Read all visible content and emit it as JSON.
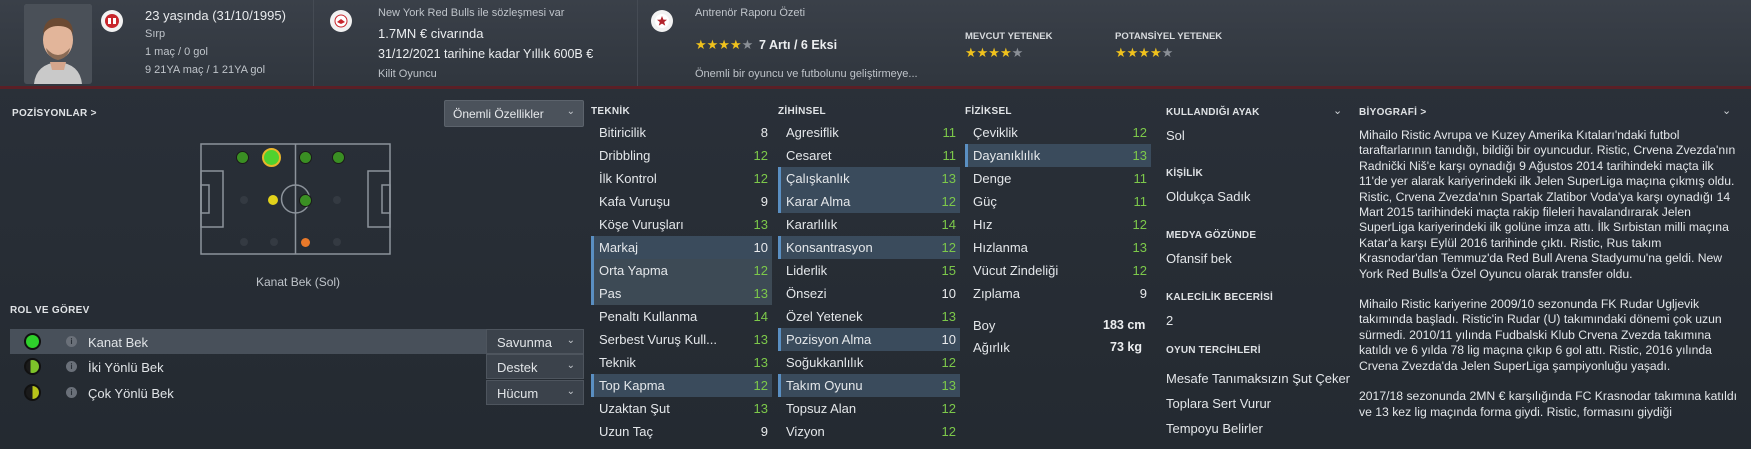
{
  "header": {
    "age_line": "23 yaşında (31/10/1995)",
    "nationality": "Sırp",
    "caps": "1 maç / 0 gol",
    "u21_caps": "9 21YA maç / 1 21YA gol",
    "contract_with": "New York Red Bulls ile sözleşmesi var",
    "value": "1.7MN € civarında",
    "contract_until": "31/12/2021 tarihine kadar Yıllık 600B €",
    "squad_status": "Kilit Oyuncu",
    "report_title": "Antrenör Raporu Özeti",
    "report_stars": 4,
    "report_summary": "7 Artı / 6 Eksi",
    "report_desc": "Önemli bir oyuncu ve futbolunu geliştirmeye...",
    "current_ability_label": "MEVCUT YETENEK",
    "current_ability_stars": 4,
    "potential_ability_label": "POTANSİYEL YETENEK",
    "potential_ability_stars": 4
  },
  "positions": {
    "title": "POZİSYONLAR",
    "chevron": ">",
    "dropdown_label": "Önemli Özellikler",
    "position_name": "Kanat Bek (Sol)"
  },
  "roles": {
    "title": "ROL VE GÖREV",
    "items": [
      {
        "name": "Kanat Bek",
        "duty": "Savunma",
        "dot_color": "#2ed02b"
      },
      {
        "name": "İki Yönlü Bek",
        "duty": "Destek",
        "dot_color": "#7ec42a"
      },
      {
        "name": "Çok Yönlü Bek",
        "duty": "Hücum",
        "dot_color": "#b8c41a"
      }
    ]
  },
  "technical": {
    "title": "TEKNİK",
    "rows": [
      {
        "label": "Bitiricilik",
        "value": "8"
      },
      {
        "label": "Dribbling",
        "value": "12"
      },
      {
        "label": "İlk Kontrol",
        "value": "12"
      },
      {
        "label": "Kafa Vuruşu",
        "value": "9"
      },
      {
        "label": "Köşe Vuruşları",
        "value": "13"
      },
      {
        "label": "Markaj",
        "value": "10"
      },
      {
        "label": "Orta Yapma",
        "value": "12"
      },
      {
        "label": "Pas",
        "value": "13"
      },
      {
        "label": "Penaltı Kullanma",
        "value": "14"
      },
      {
        "label": "Serbest Vuruş Kull...",
        "value": "13"
      },
      {
        "label": "Teknik",
        "value": "13"
      },
      {
        "label": "Top Kapma",
        "value": "12"
      },
      {
        "label": "Uzaktan Şut",
        "value": "13"
      },
      {
        "label": "Uzun Taç",
        "value": "9"
      }
    ]
  },
  "mental": {
    "title": "ZİHİNSEL",
    "rows": [
      {
        "label": "Agresiflik",
        "value": "11"
      },
      {
        "label": "Cesaret",
        "value": "11"
      },
      {
        "label": "Çalışkanlık",
        "value": "13"
      },
      {
        "label": "Karar Alma",
        "value": "12"
      },
      {
        "label": "Kararlılık",
        "value": "14"
      },
      {
        "label": "Konsantrasyon",
        "value": "12"
      },
      {
        "label": "Liderlik",
        "value": "15"
      },
      {
        "label": "Önsezi",
        "value": "10"
      },
      {
        "label": "Özel Yetenek",
        "value": "13"
      },
      {
        "label": "Pozisyon Alma",
        "value": "10"
      },
      {
        "label": "Soğukkanlılık",
        "value": "12"
      },
      {
        "label": "Takım Oyunu",
        "value": "13"
      },
      {
        "label": "Topsuz Alan",
        "value": "12"
      },
      {
        "label": "Vizyon",
        "value": "12"
      }
    ]
  },
  "physical": {
    "title": "FİZİKSEL",
    "rows": [
      {
        "label": "Çeviklik",
        "value": "12"
      },
      {
        "label": "Dayanıklılık",
        "value": "13"
      },
      {
        "label": "Denge",
        "value": "11"
      },
      {
        "label": "Güç",
        "value": "11"
      },
      {
        "label": "Hız",
        "value": "12"
      },
      {
        "label": "Hızlanma",
        "value": "13"
      },
      {
        "label": "Vücut Zindeliği",
        "value": "12"
      },
      {
        "label": "Zıplama",
        "value": "9"
      }
    ],
    "height_label": "Boy",
    "height_value": "183 cm",
    "weight_label": "Ağırlık",
    "weight_value": "73 kg"
  },
  "info": {
    "foot_label": "KULLANDIĞI AYAK",
    "foot_value": "Sol",
    "personality_label": "KİŞİLİK",
    "personality_value": "Oldukça Sadık",
    "media_label": "MEDYA GÖZÜNDE",
    "media_value": "Ofansif bek",
    "gk_label": "KALECİLİK BECERİSİ",
    "gk_value": "2",
    "prefs_label": "OYUN TERCİHLERİ",
    "prefs": [
      "Mesafe Tanımaksızın Şut Çeker",
      "Toplara Sert Vurur",
      "Tempoyu Belirler"
    ]
  },
  "bio": {
    "title": "BİYOGRAFİ",
    "chevron": ">",
    "p1": "Mihailo Ristic Avrupa ve Kuzey Amerika Kıtaları'ndaki futbol taraftarlarının tanıdığı, bildiği bir oyuncudur. Ristic, Crvena Zvezda'nın Radnički Niš'e karşı oynadığı 9 Ağustos 2014 tarihindeki maçta ilk 11'de yer alarak kariyerindeki ilk Jelen SuperLiga maçına çıkmış oldu. Ristic, Crvena Zvezda'nın Spartak Zlatibor Voda'ya karşı oynadığı 14 Mart 2015 tarihindeki maçta rakip fileleri havalandırarak Jelen SuperLiga kariyerindeki ilk golüne imza attı. İlk Sırbistan milli maçına Katar'a karşı Eylül 2016 tarihinde çıktı. Ristic, Rus takım Krasnodar'dan Temmuz'da Red Bull Arena Stadyumu'na geldi. New York Red Bulls'a Özel Oyuncu olarak transfer oldu.",
    "p2": "Mihailo Ristic kariyerine 2009/10 sezonunda FK Rudar Ugljevik takımında başladı. Ristic'in Rudar (U) takımındaki dönemi çok uzun sürmedi. 2010/11 yılında Fudbalski Klub Crvena Zvezda takımına katıldı ve 6 yılda 78 lig maçına çıkıp 6 gol attı. Ristic, 2016 yılında Crvena Zvezda'da Jelen SuperLiga şampiyonluğu yaşadı.",
    "p3": "2017/18 sezonunda 2MN € karşılığında FC Krasnodar takımına katıldı ve 13 kez lig maçında forma giydi. Ristic, formasını giydiği"
  },
  "colors": {
    "accent_green": "#7cc84a",
    "highlight_blue": "#5a8fc2",
    "star_gold": "#f0c21d",
    "header_stripe": "#5b1f26"
  }
}
